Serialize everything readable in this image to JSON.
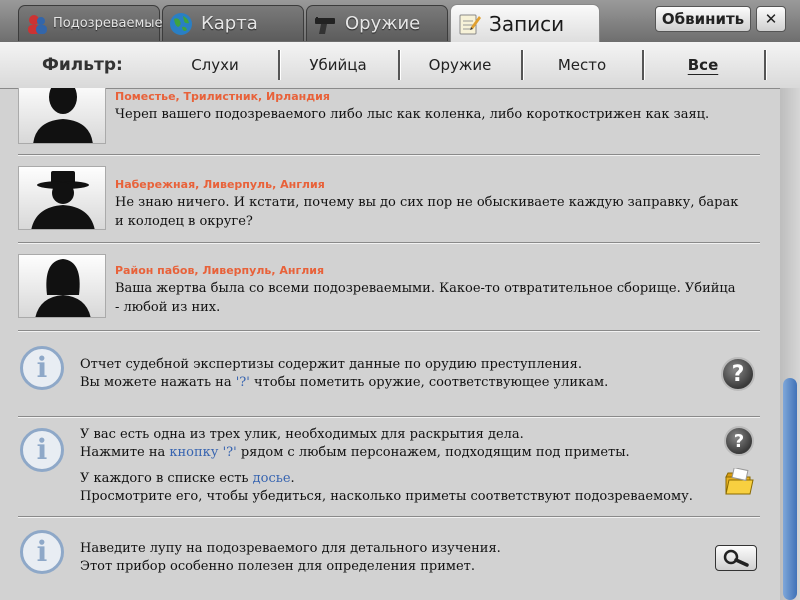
{
  "tabs": [
    {
      "label": "Подозреваемые",
      "icon": "suspects-icon"
    },
    {
      "label": "Карта",
      "icon": "globe-icon"
    },
    {
      "label": "Оружие",
      "icon": "pistol-icon"
    },
    {
      "label": "Записи",
      "icon": "notepad-icon",
      "active": true
    }
  ],
  "top_buttons": {
    "accuse": "Обвинить",
    "close": "✕"
  },
  "filter": {
    "title": "Фильтр:",
    "items": [
      "Слухи",
      "Убийца",
      "Оружие",
      "Место",
      "Все"
    ],
    "active": "Все"
  },
  "entries": [
    {
      "place": "Поместье, Трилистник, Ирландия",
      "text": "Череп вашего подозреваемого либо лыс как коленка, либо коротко­стрижен как заяц.",
      "silhouette": "bald-man"
    },
    {
      "place": "Набережная, Ливерпуль, Англия",
      "text": "Не знаю ничего. И кстати, почему вы до сих пор не обыскиваете каждую заправку, барак и колодец в округе?",
      "silhouette": "man-hat"
    },
    {
      "place": "Район пабов, Ливерпуль, Англия",
      "text": "Ваша жертва была со всеми подозреваемыми. Какое-то отвратительное сборище. Убийца - любой из них.",
      "silhouette": "woman"
    }
  ],
  "info": [
    {
      "line1": "Отчет судебной экспертизы содержит данные по орудию преступления.",
      "line2_a": "Вы можете нажать на ",
      "line2_hl": "'?'",
      "line2_b": " чтобы пометить оружие, соответствующее уликам."
    },
    {
      "line1": "У вас есть одна из трех улик, необходимых для раскрытия дела.",
      "line2_a": "Нажмите на  ",
      "line2_hl": "кнопку '?'",
      "line2_b": " рядом с любым персонажем, подходящим под приметы.",
      "line3_a": "У каждого в списке есть ",
      "line3_hl": "досье",
      "line3_b": ".",
      "line4": "Просмотрите его, чтобы убедиться, насколько приметы соответствуют подозреваемому."
    },
    {
      "line1": "Наведите лупу на подозреваемого для детального изучения.",
      "line2": "Этот прибор особенно полезен для определения примет."
    }
  ],
  "help_glyph": "?",
  "colors": {
    "place": "#e8623a",
    "highlight": "#3764b0",
    "info": "#8ea8c8",
    "scroll": "#3f72b8"
  }
}
